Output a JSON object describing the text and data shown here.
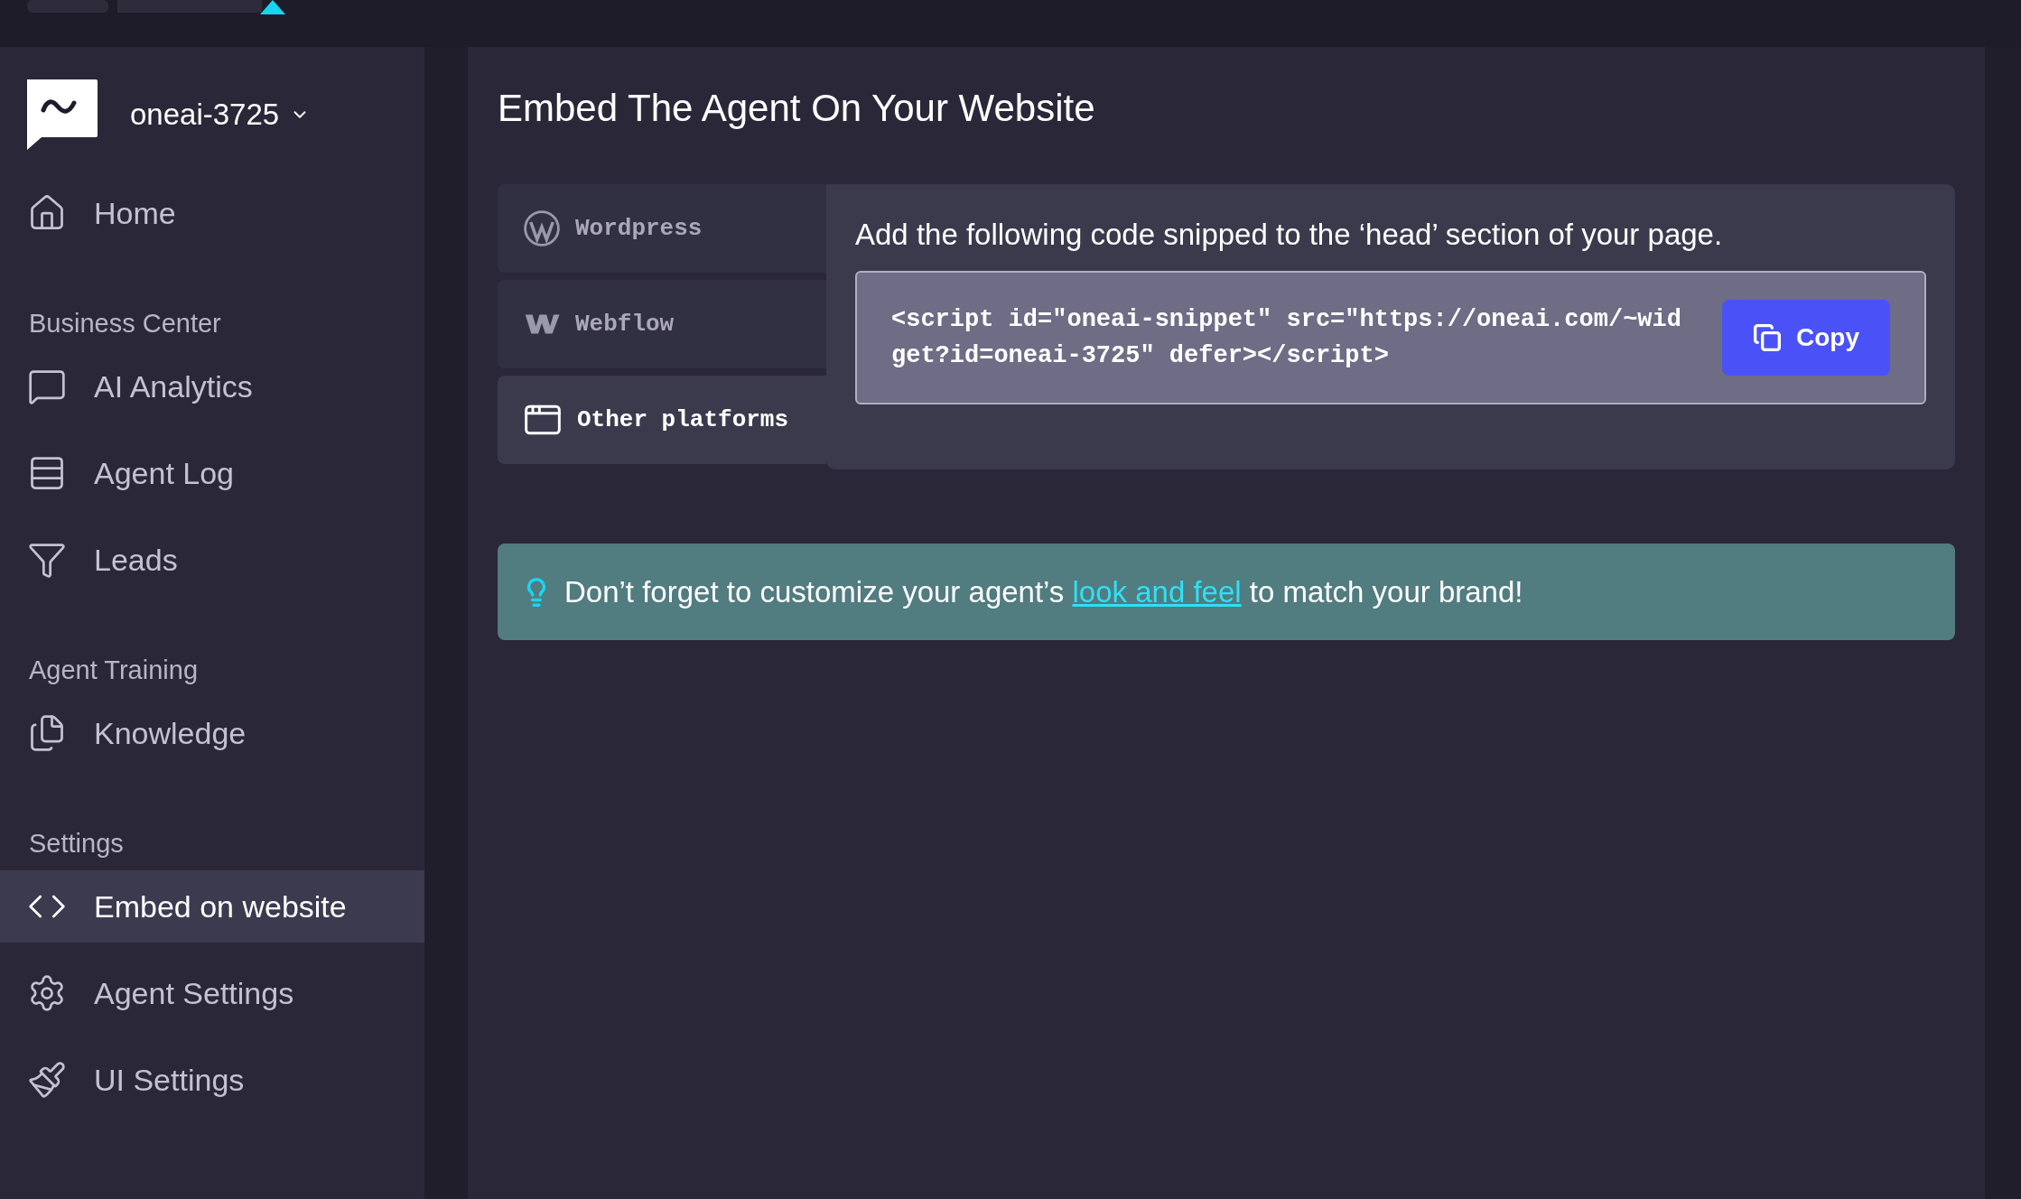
{
  "workspace": {
    "name": "oneai-3725"
  },
  "sidebar": {
    "items": [
      {
        "kind": "item",
        "label": "Home",
        "selected": false
      },
      {
        "kind": "heading",
        "label": "Business Center"
      },
      {
        "kind": "item",
        "label": "AI Analytics",
        "selected": false
      },
      {
        "kind": "item",
        "label": "Agent Log",
        "selected": false
      },
      {
        "kind": "item",
        "label": "Leads",
        "selected": false
      },
      {
        "kind": "heading",
        "label": "Agent Training"
      },
      {
        "kind": "item",
        "label": "Knowledge",
        "selected": false
      },
      {
        "kind": "heading",
        "label": "Settings"
      },
      {
        "kind": "item",
        "label": "Embed on website",
        "selected": true
      },
      {
        "kind": "item",
        "label": "Agent Settings",
        "selected": false
      },
      {
        "kind": "item",
        "label": "UI Settings",
        "selected": false
      }
    ]
  },
  "page": {
    "title": "Embed The Agent On Your Website"
  },
  "tabs": [
    {
      "label": "Wordpress",
      "selected": false
    },
    {
      "label": "Webflow",
      "selected": false
    },
    {
      "label": "Other platforms",
      "selected": true
    }
  ],
  "panel": {
    "instruction": "Add the following code snipped to the ‘head’ section of your page.",
    "code": "<script id=\"oneai-snippet\" src=\"https://oneai.com/~widget?id=oneai-3725\" defer></script>",
    "copy_button": "Copy"
  },
  "banner": {
    "before": "Don’t forget to customize your agent’s ",
    "link": "look and feel",
    "after": " to match your brand!"
  }
}
